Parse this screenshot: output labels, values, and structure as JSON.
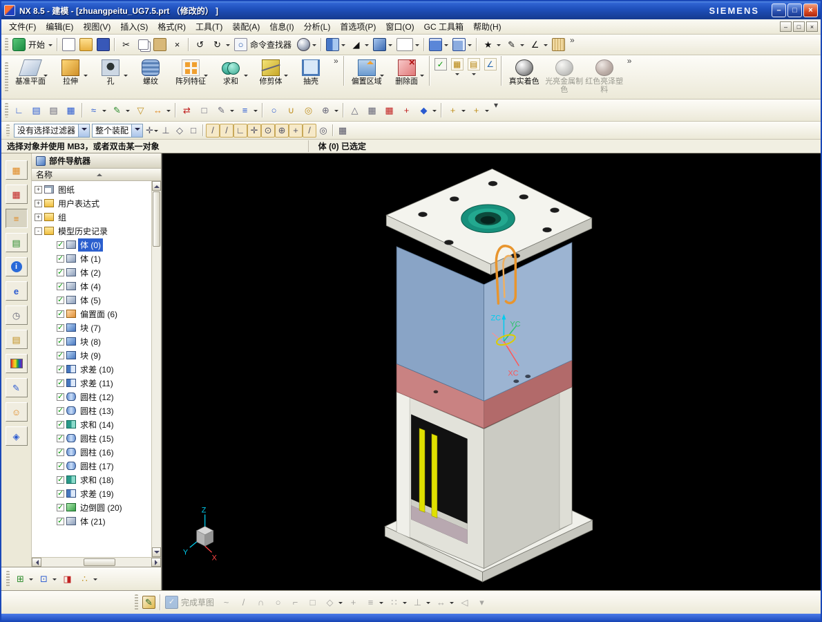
{
  "colors": {
    "selection_highlight": "#2b5fce",
    "viewport_bg": "#000000",
    "titlebar_blue": "#1e4fba",
    "accent_orange": "#e8952e"
  },
  "window": {
    "title": "NX 8.5 - 建模 - [zhuangpeitu_UG7.5.prt （修改的） ]",
    "brand": "SIEMENS",
    "controls": {
      "minimize": "–",
      "maximize": "□",
      "close": "×"
    },
    "mdi_controls": {
      "minimize": "–",
      "restore": "□",
      "close": "×"
    }
  },
  "menubar": {
    "items": [
      "文件(F)",
      "编辑(E)",
      "视图(V)",
      "插入(S)",
      "格式(R)",
      "工具(T)",
      "装配(A)",
      "信息(I)",
      "分析(L)",
      "首选项(P)",
      "窗口(O)",
      "GC 工具箱",
      "帮助(H)"
    ]
  },
  "toolbar_row1": {
    "items": [
      {
        "name": "start-button",
        "label": "开始",
        "icon": "start",
        "dropdown": true
      },
      {
        "type": "sep"
      },
      {
        "name": "new-button",
        "icon": "new-doc"
      },
      {
        "name": "open-button",
        "icon": "open-folder"
      },
      {
        "name": "save-button",
        "icon": "save"
      },
      {
        "type": "sep"
      },
      {
        "name": "cut-button",
        "icon": "cut",
        "glyph": "✂"
      },
      {
        "name": "copy-button",
        "icon": "copy"
      },
      {
        "name": "paste-button",
        "icon": "paste"
      },
      {
        "name": "delete-button",
        "icon": "delete",
        "glyph": "×"
      },
      {
        "type": "sep"
      },
      {
        "name": "undo-button",
        "icon": "undo",
        "glyph": "↺"
      },
      {
        "name": "redo-button",
        "icon": "redo",
        "glyph": "↻",
        "dropdown": true
      },
      {
        "name": "command-finder-button",
        "label": "命令查找器",
        "icon": "finder",
        "glyph": "○"
      },
      {
        "name": "view-style-button",
        "icon": "sphere",
        "dropdown": true
      },
      {
        "type": "sep"
      },
      {
        "name": "fit-window-button",
        "icon": "fit",
        "dropdown": true
      },
      {
        "name": "shaded-view-button",
        "icon": "wedge",
        "glyph": "◢",
        "dropdown": true
      },
      {
        "name": "orient-view-button",
        "icon": "cube3d",
        "dropdown": true
      },
      {
        "name": "view-layout-select",
        "icon": "viewbox",
        "dropdown": true
      },
      {
        "type": "sep"
      },
      {
        "name": "new-window-button",
        "icon": "window-blue",
        "dropdown": true
      },
      {
        "name": "cascade-window-button",
        "icon": "window-stack",
        "dropdown": true
      },
      {
        "type": "sep"
      },
      {
        "name": "synchronous-modeling-button",
        "icon": "spark",
        "glyph": "★",
        "dropdown": true
      },
      {
        "name": "sketch-task-button",
        "icon": "pencil",
        "glyph": "✎",
        "dropdown": true
      },
      {
        "name": "measure-button",
        "icon": "measure",
        "glyph": "∠",
        "dropdown": true
      },
      {
        "name": "ruler-button",
        "icon": "ruler"
      },
      {
        "type": "chevron",
        "name": "row1-overflow-chevron",
        "glyph": "»"
      }
    ]
  },
  "feature_toolbar": {
    "items": [
      {
        "name": "datum-plane-button",
        "label": "基准平面",
        "icon": "datum-plane",
        "dropdown": true
      },
      {
        "name": "extrude-button",
        "label": "拉伸",
        "icon": "extrude",
        "dropdown": true
      },
      {
        "name": "hole-button",
        "label": "孔",
        "icon": "hole",
        "dropdown": true
      },
      {
        "name": "thread-button",
        "label": "螺纹",
        "icon": "thread"
      },
      {
        "name": "pattern-feature-button",
        "label": "阵列特征",
        "icon": "pattern",
        "dropdown": true
      },
      {
        "name": "unite-button",
        "label": "求和",
        "icon": "unite-f",
        "dropdown": true
      },
      {
        "name": "trim-body-button",
        "label": "修剪体",
        "icon": "trim-body",
        "dropdown": true
      },
      {
        "name": "shell-button",
        "label": "抽壳",
        "icon": "shell"
      },
      {
        "type": "chevron",
        "name": "feature-overflow-chevron",
        "glyph": "»"
      },
      {
        "type": "sep"
      },
      {
        "name": "offset-region-button",
        "label": "偏置区域",
        "icon": "offset-region",
        "dropdown": true
      },
      {
        "name": "delete-face-button",
        "label": "删除面",
        "icon": "delete-face",
        "dropdown": true
      },
      {
        "type": "sep"
      },
      {
        "name": "check-mate-button",
        "icon": "check-green",
        "glyph": "✓",
        "small": true
      },
      {
        "name": "datum-grid-button",
        "icon": "grid-gold",
        "glyph": "▦",
        "small": true,
        "dropdown": true
      },
      {
        "name": "layer-category-button",
        "icon": "layer-gold",
        "glyph": "▤",
        "small": true,
        "dropdown": true
      },
      {
        "name": "csys-small-button",
        "icon": "csys-small",
        "glyph": "∠",
        "small": true
      },
      {
        "type": "sep"
      },
      {
        "name": "true-shading-button",
        "label": "真实着色",
        "icon": "true-shading"
      },
      {
        "name": "bright-metal-material-button",
        "label": "光亮金属制色",
        "icon": "metal-material",
        "disabled": true
      },
      {
        "name": "red-glossy-plastic-button",
        "label": "红色亮泽塑料",
        "icon": "red-plastic",
        "disabled": true
      },
      {
        "type": "chevron",
        "name": "feature-overflow-chevron-right",
        "glyph": "»"
      }
    ]
  },
  "toolbar_row3": {
    "items": [
      {
        "name": "datum-csys-button",
        "icon": "g",
        "glyph": "∟",
        "color_class": "glyph-blue"
      },
      {
        "name": "move-to-layer-button",
        "icon": "g",
        "glyph": "▤",
        "color_class": "glyph-blue"
      },
      {
        "name": "layer-settings-button",
        "icon": "g",
        "glyph": "▤",
        "color_class": "glyph-gray"
      },
      {
        "name": "layer-visible-in-view-button",
        "icon": "g",
        "glyph": "▦",
        "color_class": "glyph-blue"
      },
      {
        "type": "sep"
      },
      {
        "name": "wave-geometry-linker-button",
        "icon": "g",
        "glyph": "≈",
        "color_class": "glyph-blue",
        "dropdown": true
      },
      {
        "name": "edit-object-display-button",
        "icon": "g",
        "glyph": "✎",
        "color_class": "glyph-green",
        "dropdown": true
      },
      {
        "name": "show-hide-button",
        "icon": "g",
        "glyph": "▽",
        "color_class": "glyph-gold"
      },
      {
        "name": "move-object-button",
        "icon": "g",
        "glyph": "↔",
        "color_class": "glyph-or",
        "dropdown": true
      },
      {
        "type": "sep"
      },
      {
        "name": "sync-arrows-button",
        "icon": "g",
        "glyph": "⇄",
        "color_class": "glyph-red"
      },
      {
        "name": "eraser-button",
        "icon": "g",
        "glyph": "□",
        "color_class": "glyph-gray"
      },
      {
        "name": "edit-sketch-button",
        "icon": "g",
        "glyph": "✎",
        "color_class": "glyph-gray",
        "dropdown": true
      },
      {
        "name": "curve-lines-button",
        "icon": "g",
        "glyph": "≡",
        "color_class": "glyph-blue",
        "dropdown": true
      },
      {
        "type": "sep"
      },
      {
        "name": "cylinder-tool-button",
        "icon": "g",
        "glyph": "○",
        "color_class": "glyph-blue"
      },
      {
        "name": "clip-section-button",
        "icon": "g",
        "glyph": "∪",
        "color_class": "glyph-gold"
      },
      {
        "name": "torus-tool-button",
        "icon": "g",
        "glyph": "◎",
        "color_class": "glyph-gold"
      },
      {
        "name": "gear-tool-button",
        "icon": "g",
        "glyph": "⊕",
        "color_class": "glyph-gray",
        "dropdown": true
      },
      {
        "type": "sep"
      },
      {
        "name": "triangle-tool-button",
        "icon": "g",
        "glyph": "△",
        "color_class": "glyph-gray"
      },
      {
        "name": "table-annotation-button",
        "icon": "g",
        "glyph": "▦",
        "color_class": "glyph-gray"
      },
      {
        "name": "grid-tool-button",
        "icon": "g",
        "glyph": "▦",
        "color_class": "glyph-red"
      },
      {
        "name": "tools-button",
        "icon": "g",
        "glyph": "+",
        "color_class": "glyph-red"
      },
      {
        "name": "analysis-tool-button",
        "icon": "g",
        "glyph": "◆",
        "color_class": "glyph-blue",
        "dropdown": true
      },
      {
        "type": "sep"
      },
      {
        "name": "quick-add-1-button",
        "icon": "g",
        "glyph": "+",
        "color_class": "glyph-gold",
        "dropdown": true
      },
      {
        "name": "quick-add-2-button",
        "icon": "g",
        "glyph": "+",
        "color_class": "glyph-gold",
        "dropdown": true
      },
      {
        "type": "chevron",
        "name": "row3-overflow-chevron",
        "glyph": "▾"
      }
    ]
  },
  "selection_bar": {
    "filter_dropdown": "没有选择过滤器",
    "scope_dropdown": "整个装配",
    "snap_items": [
      {
        "name": "general-point-button",
        "glyph": "✛",
        "dropdown": true
      },
      {
        "name": "point-dialog-button",
        "glyph": "⊥"
      },
      {
        "name": "select-face-button",
        "glyph": "◇"
      },
      {
        "name": "select-body-button",
        "glyph": "□"
      },
      {
        "type": "sep"
      },
      {
        "name": "snap-end-point-button",
        "glyph": "/",
        "pressed": true
      },
      {
        "name": "snap-mid-point-button",
        "glyph": "/",
        "pressed": true
      },
      {
        "name": "snap-control-point-button",
        "glyph": "∟",
        "pressed": true
      },
      {
        "name": "snap-intersection-button",
        "glyph": "✛",
        "pressed": true
      },
      {
        "name": "snap-arc-center-button",
        "glyph": "⊙",
        "pressed": true
      },
      {
        "name": "snap-quadrant-button",
        "glyph": "⊕",
        "pressed": true
      },
      {
        "name": "snap-existing-point-button",
        "glyph": "+",
        "pressed": true
      },
      {
        "name": "snap-point-on-curve-button",
        "glyph": "/",
        "pressed": true
      },
      {
        "name": "snap-point-on-face-button",
        "glyph": "◎"
      },
      {
        "type": "sep"
      },
      {
        "name": "grid-table-button",
        "glyph": "▦"
      }
    ]
  },
  "prompt_bar": {
    "message": "选择对象并使用 MB3，或者双击某一对象",
    "status": "体 (0) 已选定"
  },
  "resource_strip": {
    "items": [
      {
        "name": "assembly-navigator",
        "glyph": "▦",
        "color_class": "glyph-or"
      },
      {
        "name": "constraint-navigator",
        "glyph": "▦",
        "color_class": "glyph-red"
      },
      {
        "name": "part-navigator",
        "glyph": "≡",
        "color_class": "glyph-or",
        "pressed": true
      },
      {
        "name": "reuse-library",
        "glyph": "▤",
        "color_class": "glyph-green"
      },
      {
        "name": "hd3d-tools",
        "glyph": "i",
        "hd3d": true
      },
      {
        "name": "web-browser",
        "glyph": "e",
        "color_class": "glyph-blue"
      },
      {
        "name": "history",
        "glyph": "◷",
        "color_class": "glyph-gray"
      },
      {
        "name": "system-materials",
        "glyph": "▤",
        "color_class": "glyph-gold"
      },
      {
        "name": "scene-palette",
        "rainbow": true
      },
      {
        "name": "process-studio",
        "glyph": "✎",
        "color_class": "glyph-blue"
      },
      {
        "name": "roles",
        "glyph": "☺",
        "color_class": "glyph-or"
      },
      {
        "name": "visualization-scene",
        "glyph": "◈",
        "color_class": "glyph-blue"
      }
    ]
  },
  "part_navigator": {
    "title": "部件导航器",
    "column_header": "名称",
    "rows": [
      {
        "label": "图纸",
        "icon": "drawing",
        "level": 0,
        "expand": "+"
      },
      {
        "label": "用户表达式",
        "icon": "folder",
        "level": 0,
        "expand": "+"
      },
      {
        "label": "组",
        "icon": "folder",
        "level": 0,
        "expand": "+"
      },
      {
        "label": "模型历史记录",
        "icon": "folder-open",
        "level": 0,
        "expand": "-"
      },
      {
        "label": "体 (0)",
        "icon": "body",
        "level": 1,
        "checked": true,
        "selected": true
      },
      {
        "label": "体 (1)",
        "icon": "body",
        "level": 1,
        "checked": true
      },
      {
        "label": "体 (2)",
        "icon": "body",
        "level": 1,
        "checked": true
      },
      {
        "label": "体 (4)",
        "icon": "body",
        "level": 1,
        "checked": true
      },
      {
        "label": "体 (5)",
        "icon": "body",
        "level": 1,
        "checked": true
      },
      {
        "label": "偏置面 (6)",
        "icon": "offset-face",
        "level": 1,
        "checked": true
      },
      {
        "label": "块 (7)",
        "icon": "block",
        "level": 1,
        "checked": true
      },
      {
        "label": "块 (8)",
        "icon": "block",
        "level": 1,
        "checked": true
      },
      {
        "label": "块 (9)",
        "icon": "block",
        "level": 1,
        "checked": true
      },
      {
        "label": "求差 (10)",
        "icon": "subtract",
        "level": 1,
        "checked": true
      },
      {
        "label": "求差 (11)",
        "icon": "subtract",
        "level": 1,
        "checked": true
      },
      {
        "label": "圆柱 (12)",
        "icon": "cylinder",
        "level": 1,
        "checked": true
      },
      {
        "label": "圆柱 (13)",
        "icon": "cylinder",
        "level": 1,
        "checked": true
      },
      {
        "label": "求和 (14)",
        "icon": "unite",
        "level": 1,
        "checked": true
      },
      {
        "label": "圆柱 (15)",
        "icon": "cylinder",
        "level": 1,
        "checked": true
      },
      {
        "label": "圆柱 (16)",
        "icon": "cylinder",
        "level": 1,
        "checked": true
      },
      {
        "label": "圆柱 (17)",
        "icon": "cylinder",
        "level": 1,
        "checked": true
      },
      {
        "label": "求和 (18)",
        "icon": "unite",
        "level": 1,
        "checked": true
      },
      {
        "label": "求差 (19)",
        "icon": "subtract",
        "level": 1,
        "checked": true
      },
      {
        "label": "边倒圆 (20)",
        "icon": "blend",
        "level": 1,
        "checked": true
      },
      {
        "label": "体 (21)",
        "icon": "body",
        "level": 1,
        "checked": true
      }
    ]
  },
  "navigator_bottom_bar": {
    "items": [
      {
        "name": "timestamp-order-button",
        "glyph": "⊞",
        "color_class": "glyph-green",
        "dropdown": true
      },
      {
        "name": "export-navigator-button",
        "glyph": "⊡",
        "color_class": "glyph-blue",
        "dropdown": true
      },
      {
        "name": "filter-flag-button",
        "glyph": "◨",
        "color_class": "glyph-red"
      },
      {
        "name": "navigator-more-button",
        "glyph": "∴",
        "color_class": "glyph-gold",
        "dropdown": true
      }
    ]
  },
  "sketch_toolbar": {
    "items": [
      {
        "name": "sketch-button",
        "icon": "sketch-color",
        "glyph": "✎"
      },
      {
        "type": "sep"
      },
      {
        "name": "finish-sketch-button",
        "label": "完成草图",
        "icon": "finish",
        "glyph": "✓",
        "disabled": true
      },
      {
        "name": "spline-button",
        "glyph": "~",
        "disabled": true
      },
      {
        "name": "line-button",
        "glyph": "/",
        "disabled": true
      },
      {
        "name": "arc-button",
        "glyph": "∩",
        "disabled": true
      },
      {
        "name": "circle-button",
        "glyph": "○",
        "disabled": true
      },
      {
        "name": "fillet-button",
        "glyph": "⌐",
        "disabled": true
      },
      {
        "name": "rectangle-button",
        "glyph": "□",
        "disabled": true
      },
      {
        "name": "polygon-button",
        "glyph": "◇",
        "disabled": true,
        "dropdown": true
      },
      {
        "name": "point-button",
        "glyph": "+",
        "disabled": true
      },
      {
        "name": "offset-curve-button",
        "glyph": "≡",
        "disabled": true,
        "dropdown": true
      },
      {
        "name": "pattern-curve-button",
        "glyph": "∷",
        "disabled": true,
        "dropdown": true
      },
      {
        "name": "constraint-button",
        "glyph": "⊥",
        "disabled": true,
        "dropdown": true
      },
      {
        "name": "dimension-button",
        "glyph": "↔",
        "disabled": true,
        "dropdown": true
      },
      {
        "name": "mirror-curve-button",
        "glyph": "◁",
        "disabled": true
      },
      {
        "name": "more-sketch-button",
        "glyph": "▾",
        "disabled": true
      }
    ]
  },
  "viewport": {
    "wcs": {
      "z": "ZC",
      "y": "YC",
      "x": "XC"
    },
    "triad": {
      "z": "Z",
      "x": "X",
      "y": "Y"
    }
  }
}
